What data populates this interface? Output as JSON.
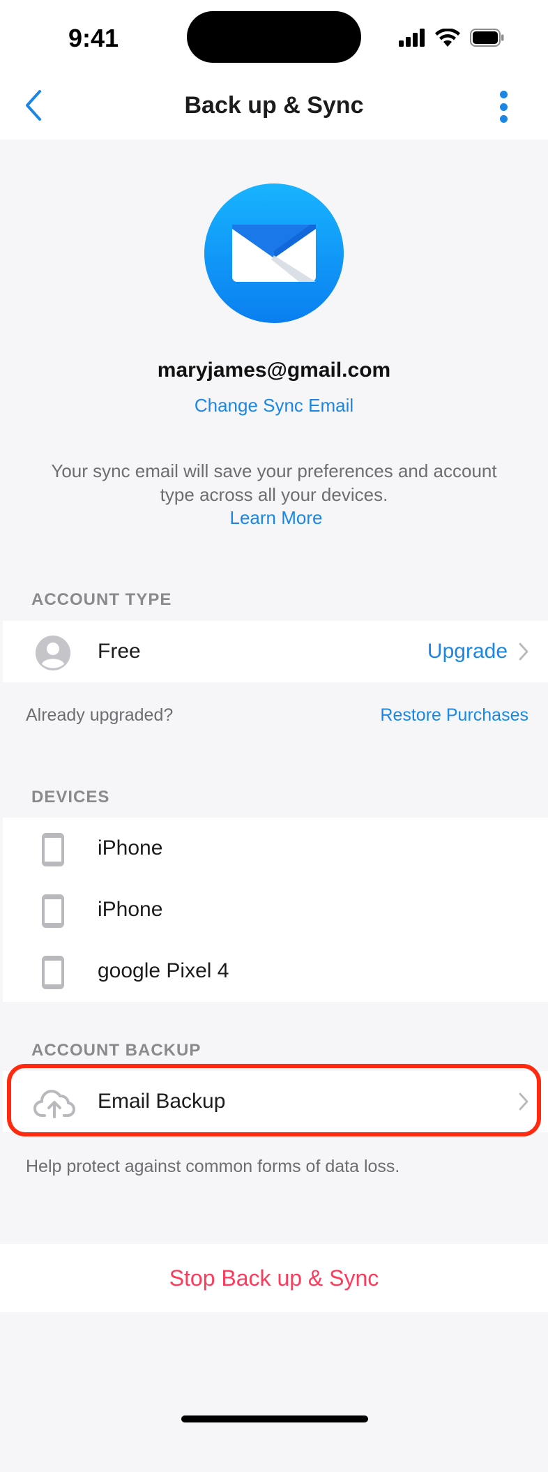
{
  "status_bar": {
    "time": "9:41"
  },
  "nav": {
    "title": "Back up & Sync"
  },
  "profile": {
    "email": "maryjames@gmail.com",
    "change_link": "Change Sync Email",
    "description": "Your sync email will save your preferences and account type across all your devices.",
    "learn_more": "Learn More"
  },
  "account_type": {
    "header": "ACCOUNT TYPE",
    "plan": "Free",
    "upgrade_label": "Upgrade",
    "already_upgraded": "Already upgraded?",
    "restore_label": "Restore Purchases"
  },
  "devices": {
    "header": "DEVICES",
    "items": [
      {
        "label": "iPhone"
      },
      {
        "label": "iPhone"
      },
      {
        "label": "google Pixel 4"
      }
    ]
  },
  "account_backup": {
    "header": "ACCOUNT BACKUP",
    "item_label": "Email Backup",
    "note": "Help protect against common forms of data loss."
  },
  "stop_button": {
    "label": "Stop Back up & Sync"
  },
  "colors": {
    "accent": "#1a87e6",
    "destructive": "#ff3b5c",
    "highlight": "#ff2a10",
    "background": "#f6f6f8"
  }
}
